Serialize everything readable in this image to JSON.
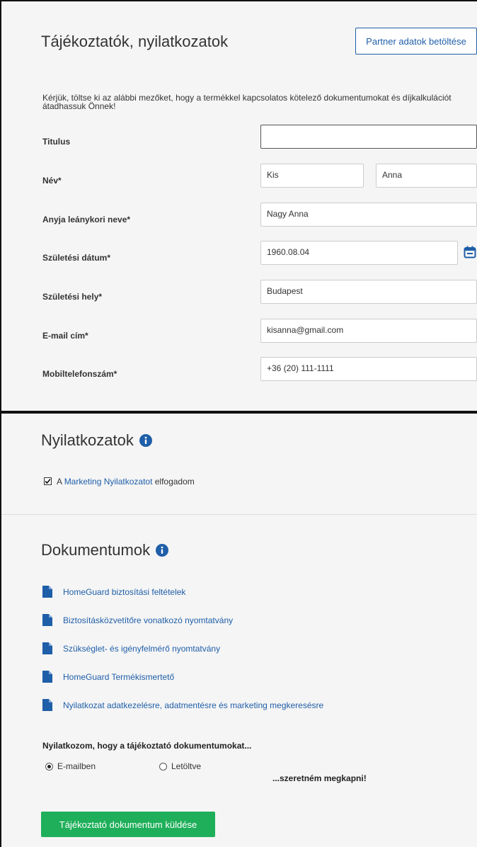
{
  "info": {
    "title": "Tájékoztatók, nyilatkozatok",
    "load_partner_label": "Partner adatok betöltése",
    "intro": "Kérjük, töltse ki az alábbi mezőket, hogy a termékkel kapcsolatos kötelező dokumentumokat és díjkalkulációt átadhassuk Önnek!"
  },
  "form": {
    "titulus_label": "Titulus",
    "titulus_value": "",
    "nev_label": "Név*",
    "first_name": "Kis",
    "last_name": "Anna",
    "mother_label": "Anyja leánykori neve*",
    "mother_value": "Nagy Anna",
    "birth_date_label": "Születési dátum*",
    "birth_date_value": "1960.08.04",
    "birth_place_label": "Születési hely*",
    "birth_place_value": "Budapest",
    "email_label": "E-mail cím*",
    "email_value": "kisanna@gmail.com",
    "phone_label": "Mobiltelefonszám*",
    "phone_value": "+36 (20) 111-1111"
  },
  "declarations": {
    "title": "Nyilatkozatok",
    "marketing_prefix": "A ",
    "marketing_link": "Marketing Nyilatkozatot",
    "marketing_suffix": " elfogadom",
    "marketing_checked": true
  },
  "documents": {
    "title": "Dokumentumok",
    "items": [
      "HomeGuard biztosítási feltételek",
      "Biztosításközvetítőre vonatkozó nyomtatvány",
      "Szükséglet- és igényfelmérő nyomtatvány",
      "HomeGuard Termékismertető",
      "Nyilatkozat adatkezelésre, adatmentésre és marketing megkeresésre"
    ]
  },
  "delivery": {
    "question": "Nyilatkozom, hogy a tájékoztató dokumentumokat...",
    "option_email": "E-mailben",
    "option_download": "Letöltve",
    "selected": "email",
    "suffix": "...szeretném megkapni!",
    "send_label": "Tájékoztató dokumentum küldése"
  },
  "colors": {
    "accent": "#1f5ea8",
    "send_button": "#1faf5a",
    "background": "#f5f5f5"
  }
}
